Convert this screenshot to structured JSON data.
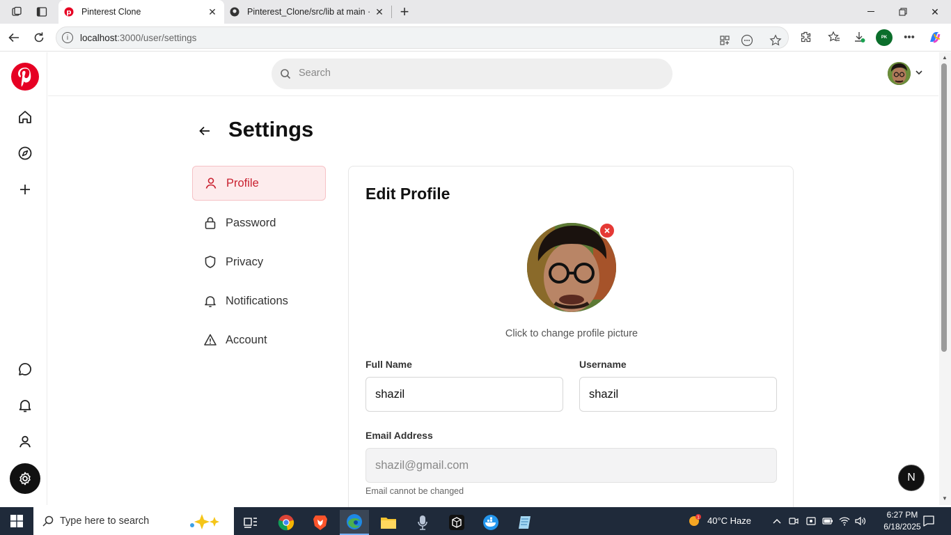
{
  "browser": {
    "tabs": [
      {
        "title": "Pinterest Clone",
        "active": true
      },
      {
        "title": "Pinterest_Clone/src/lib at main · N",
        "active": false
      }
    ],
    "url_host": "localhost",
    "url_path": ":3000/user/settings"
  },
  "header": {
    "search_placeholder": "Search"
  },
  "page": {
    "title": "Settings"
  },
  "settings_menu": [
    {
      "label": "Profile",
      "icon": "user-icon",
      "active": true
    },
    {
      "label": "Password",
      "icon": "lock-icon",
      "active": false
    },
    {
      "label": "Privacy",
      "icon": "shield-icon",
      "active": false
    },
    {
      "label": "Notifications",
      "icon": "bell-icon",
      "active": false
    },
    {
      "label": "Account",
      "icon": "warning-icon",
      "active": false
    }
  ],
  "profile": {
    "heading": "Edit Profile",
    "picture_hint": "Click to change profile picture",
    "full_name_label": "Full Name",
    "full_name_value": "shazil",
    "username_label": "Username",
    "username_value": "shazil",
    "email_label": "Email Address",
    "email_value": "shazil@gmail.com",
    "email_help": "Email cannot be changed"
  },
  "colors": {
    "brand": "#e60023",
    "active_menu_bg": "#fdeced",
    "active_menu_text": "#c9202f"
  },
  "dev_badge": "N",
  "taskbar": {
    "search_placeholder": "Type here to search",
    "weather": "40°C  Haze",
    "time": "6:27 PM",
    "date": "6/18/2025"
  }
}
